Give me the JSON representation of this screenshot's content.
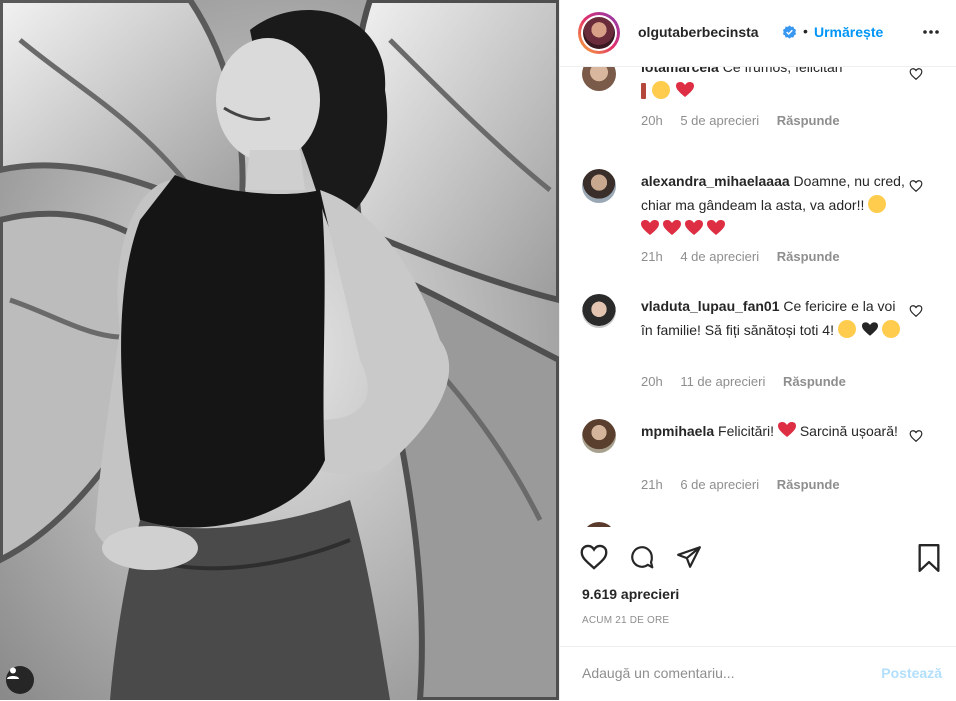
{
  "post": {
    "photo_alt": "black and white portrait with butterfly wings background"
  },
  "header": {
    "username": "olgutaberbecinsta",
    "separator": "•",
    "follow_label": "Urmărește"
  },
  "comments": [
    {
      "username": "iotamarcela",
      "text": "Ce frumos, felicitări",
      "age": "20h",
      "likes": "5 de aprecieri",
      "reply_label": "Răspunde"
    },
    {
      "username": "alexandra_mihaelaaaa",
      "text": "Doamne, nu cred, chiar ma gândeam la asta, va ador!!",
      "age": "21h",
      "likes": "4 de aprecieri",
      "reply_label": "Răspunde"
    },
    {
      "username": "vladuta_lupau_fan01",
      "text": "Ce fericire e la voi în familie! Să fiți sănătoși toti 4!",
      "age": "20h",
      "likes": "11 de aprecieri",
      "reply_label": "Răspunde"
    },
    {
      "username": "mpmihaela",
      "text": "Felicitări!",
      "text2": "Sarcină ușoară!",
      "age": "21h",
      "likes": "6 de aprecieri",
      "reply_label": "Răspunde"
    }
  ],
  "stats": {
    "likes": "9.619 aprecieri",
    "posted": "Acum 21 de ore"
  },
  "composer": {
    "placeholder": "Adaugă un comentariu...",
    "post_label": "Postează"
  },
  "icons": {
    "like": "heart-icon",
    "comment": "comment-icon",
    "share": "share-icon",
    "save": "bookmark-icon",
    "verified": "verified-badge-icon",
    "more": "more-options-icon"
  },
  "colors": {
    "accent": "#0095f6",
    "verified": "#3897f0",
    "muted": "#8e8e8e",
    "heart_red": "#dd2e44"
  }
}
